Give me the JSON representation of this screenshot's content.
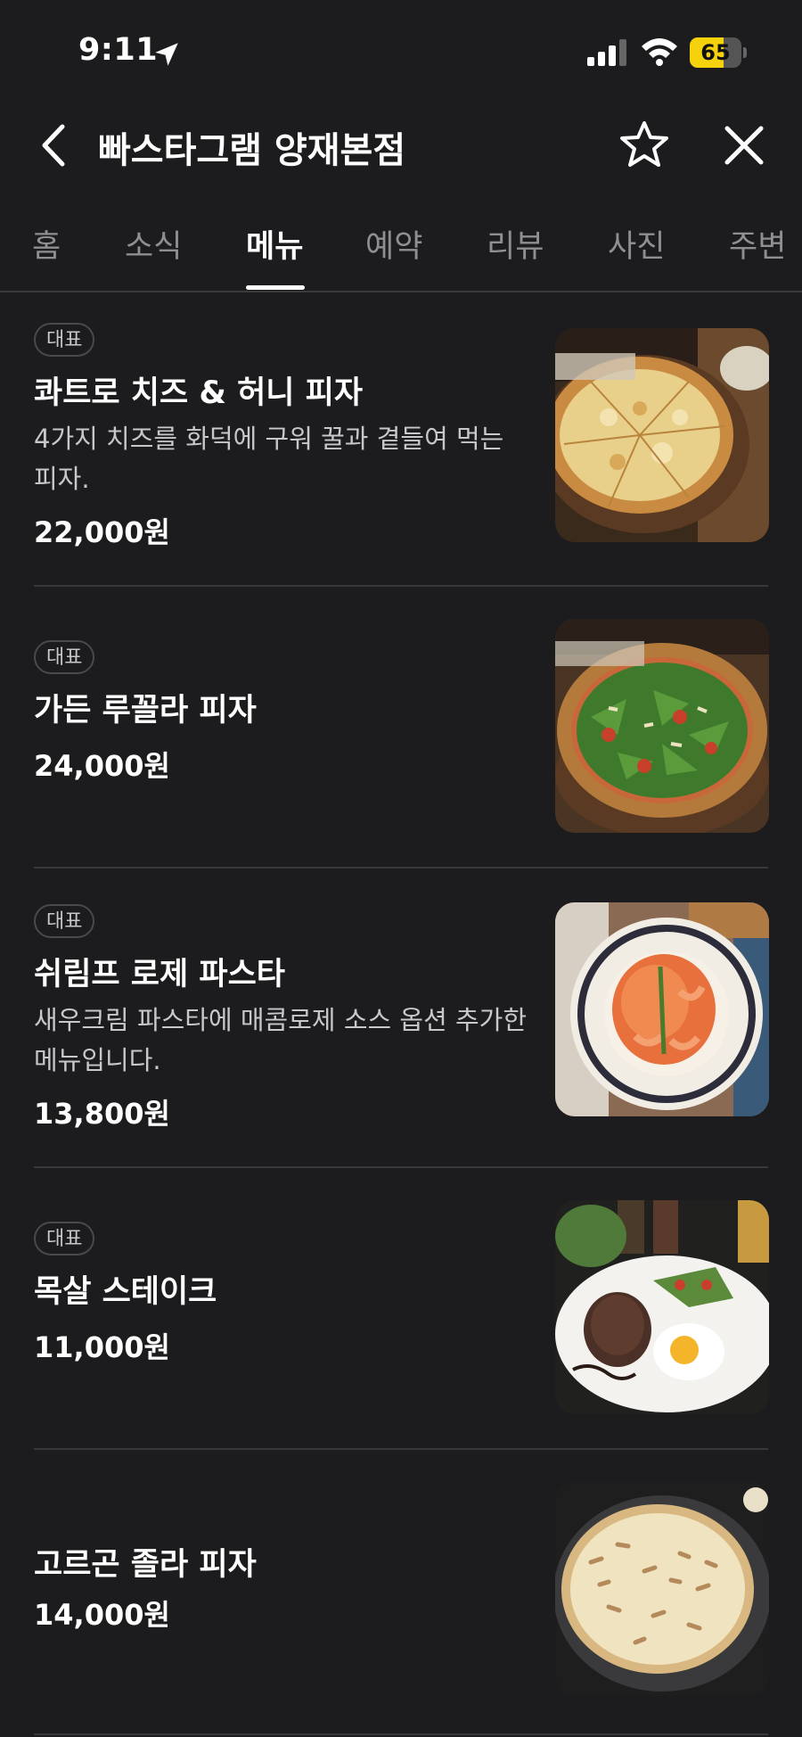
{
  "status_bar": {
    "time": "9:11",
    "battery": "65",
    "battery_level": 0.65
  },
  "header": {
    "title": "빠스타그램 양재본점"
  },
  "tabs": [
    {
      "label": "홈"
    },
    {
      "label": "소식"
    },
    {
      "label": "메뉴",
      "active": true
    },
    {
      "label": "예약"
    },
    {
      "label": "리뷰"
    },
    {
      "label": "사진"
    },
    {
      "label": "주변"
    }
  ],
  "menu": [
    {
      "badge": "대표",
      "name": "콰트로 치즈 & 허니 피자",
      "description": "4가지 치즈를 화덕에 구워 꿀과 곁들여 먹는 피자.",
      "price": "22,000원",
      "photo": "quattro-cheese-pizza-photo"
    },
    {
      "badge": "대표",
      "name": "가든 루꼴라 피자",
      "description": "",
      "price": "24,000원",
      "photo": "arugula-pizza-photo"
    },
    {
      "badge": "대표",
      "name": "쉬림프 로제 파스타",
      "description": "새우크림 파스타에 매콤로제 소스 옵션 추가한 메뉴입니다.",
      "price": "13,800원",
      "photo": "shrimp-rose-pasta-photo"
    },
    {
      "badge": "대표",
      "name": "목살 스테이크",
      "description": "",
      "price": "11,000원",
      "photo": "pork-steak-photo"
    },
    {
      "badge": "",
      "name": "고르곤 졸라 피자",
      "description": "",
      "price": "14,000원",
      "photo": "gorgonzola-pizza-photo"
    }
  ]
}
